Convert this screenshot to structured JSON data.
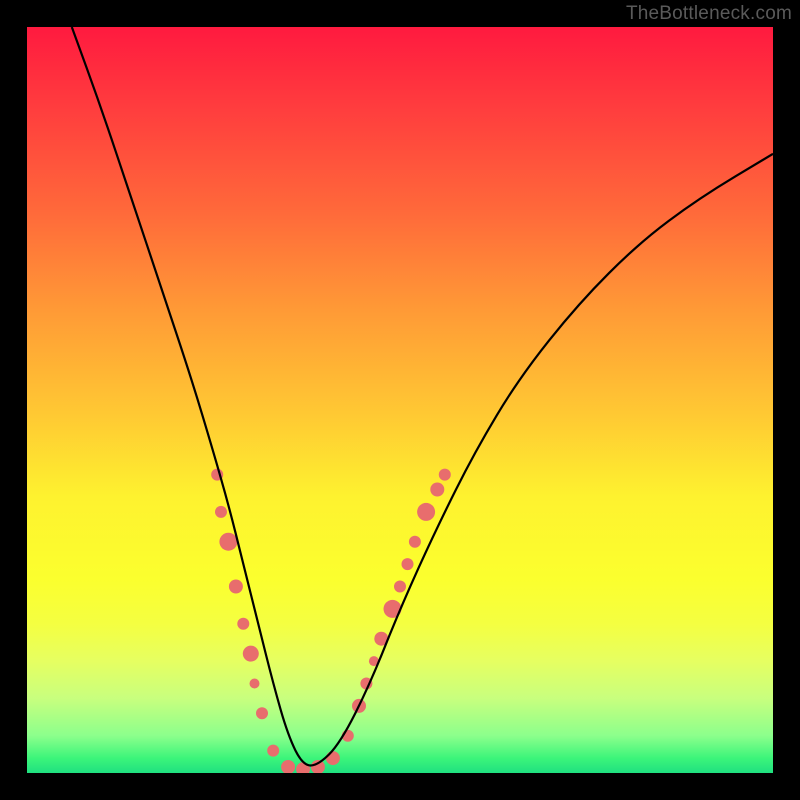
{
  "watermark": "TheBottleneck.com",
  "chart_data": {
    "type": "line",
    "title": "",
    "xlabel": "",
    "ylabel": "",
    "xlim": [
      0,
      100
    ],
    "ylim": [
      0,
      100
    ],
    "series": [
      {
        "name": "bottleneck-curve",
        "x": [
          6,
          10,
          14,
          18,
          22,
          25,
          27,
          29,
          31,
          33,
          35,
          37,
          39,
          42,
          46,
          50,
          55,
          60,
          66,
          74,
          82,
          90,
          100
        ],
        "values": [
          100,
          89,
          77,
          65,
          53,
          43,
          36,
          28,
          20,
          12,
          5,
          1,
          1,
          4,
          12,
          22,
          33,
          43,
          53,
          63,
          71,
          77,
          83
        ]
      }
    ],
    "markers": {
      "name": "highlighted-points",
      "color": "#e86d6d",
      "points": [
        {
          "x": 25.5,
          "y": 40,
          "r": 6
        },
        {
          "x": 26.0,
          "y": 35,
          "r": 6
        },
        {
          "x": 27.0,
          "y": 31,
          "r": 9
        },
        {
          "x": 28.0,
          "y": 25,
          "r": 7
        },
        {
          "x": 29.0,
          "y": 20,
          "r": 6
        },
        {
          "x": 30.0,
          "y": 16,
          "r": 8
        },
        {
          "x": 30.5,
          "y": 12,
          "r": 5
        },
        {
          "x": 31.5,
          "y": 8,
          "r": 6
        },
        {
          "x": 33.0,
          "y": 3,
          "r": 6
        },
        {
          "x": 35.0,
          "y": 0.8,
          "r": 7
        },
        {
          "x": 37.0,
          "y": 0.5,
          "r": 7
        },
        {
          "x": 39.0,
          "y": 0.8,
          "r": 7
        },
        {
          "x": 41.0,
          "y": 2,
          "r": 7
        },
        {
          "x": 43.0,
          "y": 5,
          "r": 6
        },
        {
          "x": 44.5,
          "y": 9,
          "r": 7
        },
        {
          "x": 45.5,
          "y": 12,
          "r": 6
        },
        {
          "x": 46.5,
          "y": 15,
          "r": 5
        },
        {
          "x": 47.5,
          "y": 18,
          "r": 7
        },
        {
          "x": 49.0,
          "y": 22,
          "r": 9
        },
        {
          "x": 50.0,
          "y": 25,
          "r": 6
        },
        {
          "x": 51.0,
          "y": 28,
          "r": 6
        },
        {
          "x": 52.0,
          "y": 31,
          "r": 6
        },
        {
          "x": 53.5,
          "y": 35,
          "r": 9
        },
        {
          "x": 55.0,
          "y": 38,
          "r": 7
        },
        {
          "x": 56.0,
          "y": 40,
          "r": 6
        }
      ]
    }
  }
}
